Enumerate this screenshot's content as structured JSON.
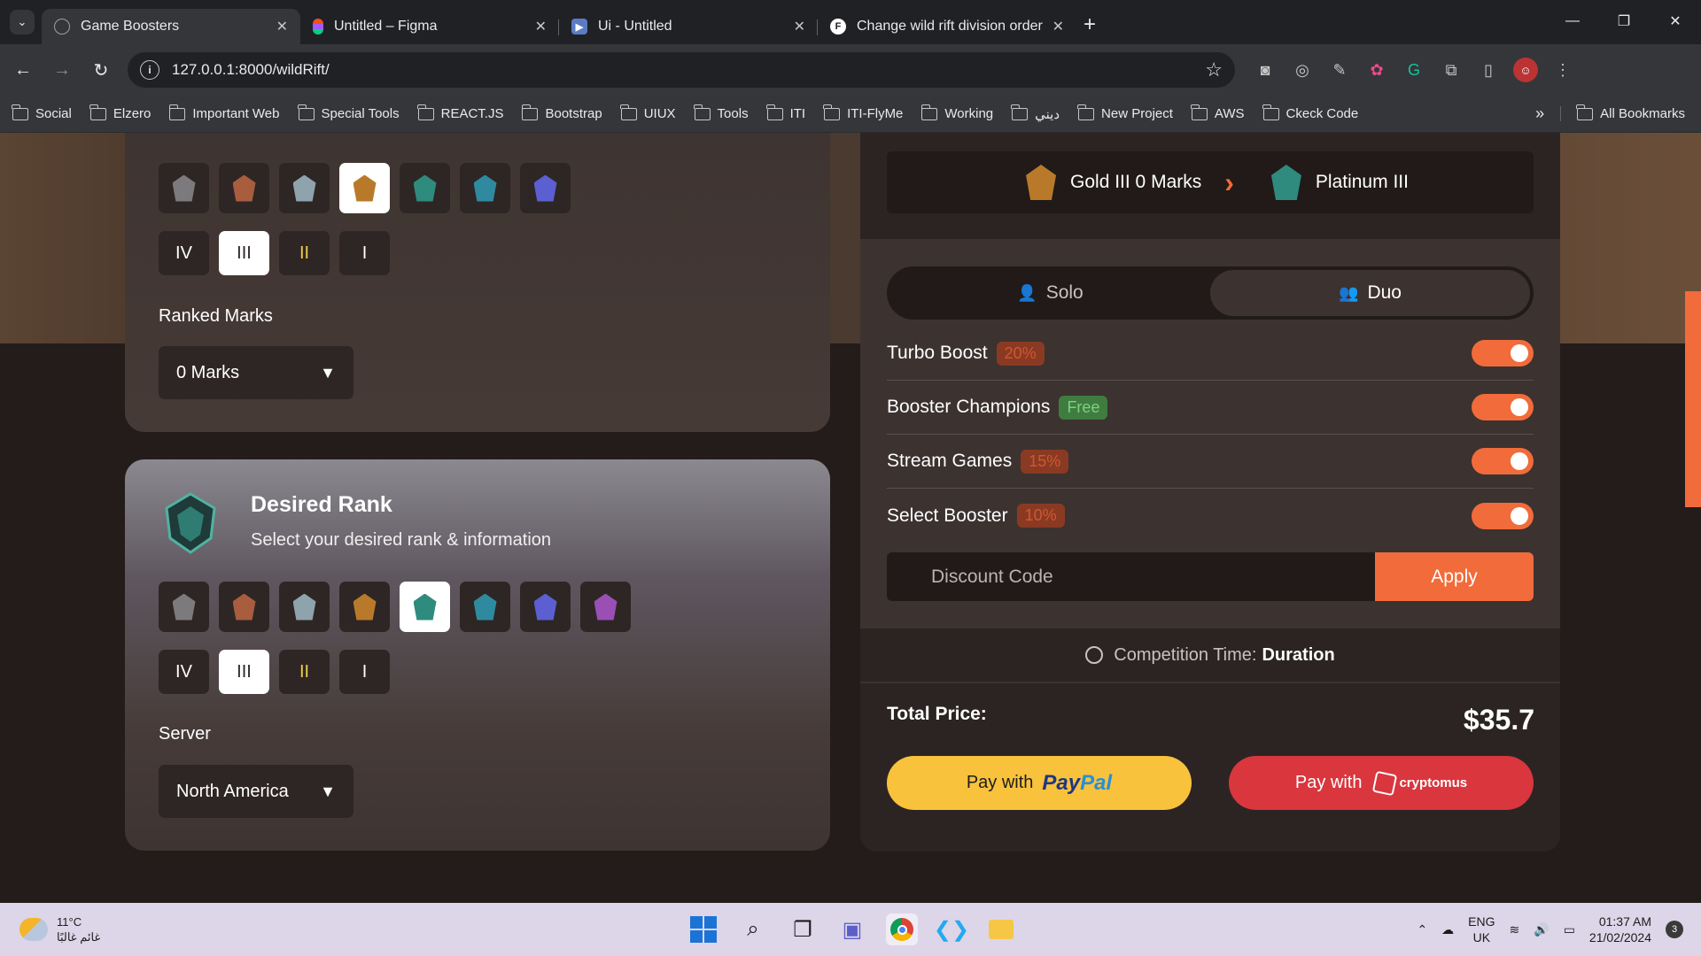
{
  "browser": {
    "tabs": [
      {
        "title": "Game Boosters",
        "active": true
      },
      {
        "title": "Untitled – Figma",
        "active": false
      },
      {
        "title": "Ui - Untitled",
        "active": false
      },
      {
        "title": "Change wild rift division order |",
        "active": false
      }
    ],
    "url": "127.0.0.1:8000/wildRift/",
    "bookmarks": [
      "Social",
      "Elzero",
      "Important Web",
      "Special Tools",
      "REACT.JS",
      "Bootstrap",
      "UIUX",
      "Tools",
      "ITI",
      "ITI-FlyMe",
      "Working",
      "ديني",
      "New Project",
      "AWS",
      "Ckeck Code"
    ],
    "all_bookmarks": "All Bookmarks"
  },
  "current_rank": {
    "divisions": [
      "IV",
      "III",
      "II",
      "I"
    ],
    "selected_division": "III",
    "marks_label": "Ranked Marks",
    "marks_value": "0 Marks"
  },
  "desired_rank": {
    "title": "Desired Rank",
    "subtitle": "Select your desired rank & information",
    "divisions": [
      "IV",
      "III",
      "II",
      "I"
    ],
    "selected_division": "III",
    "server_label": "Server",
    "server_value": "North America"
  },
  "summary": {
    "from": "Gold III 0 Marks",
    "to": "Platinum III"
  },
  "mode": {
    "solo": "Solo",
    "duo": "Duo",
    "selected": "Duo"
  },
  "options": [
    {
      "label": "Turbo Boost",
      "badge": "20%",
      "on": true
    },
    {
      "label": "Booster Champions",
      "badge": "Free",
      "on": true
    },
    {
      "label": "Stream Games",
      "badge": "15%",
      "on": true
    },
    {
      "label": "Select Booster",
      "badge": "10%",
      "on": true
    }
  ],
  "discount": {
    "placeholder": "Discount Code",
    "apply": "Apply"
  },
  "competition": {
    "label": "Competition Time:",
    "value": "Duration"
  },
  "total": {
    "label": "Total Price:",
    "value": "$35.7"
  },
  "pay": {
    "prefix": "Pay with",
    "paypal_a": "Pay",
    "paypal_b": "Pal",
    "crypto": "cryptomus"
  },
  "colors": {
    "accent": "#f26b3a",
    "paypal": "#f9c23c",
    "crypto": "#d9363e"
  },
  "taskbar": {
    "temp": "11°C",
    "weather": "غائم غالبًا",
    "lang": "ENG",
    "region": "UK",
    "time": "01:37 AM",
    "date": "21/02/2024",
    "notifications": "3"
  }
}
